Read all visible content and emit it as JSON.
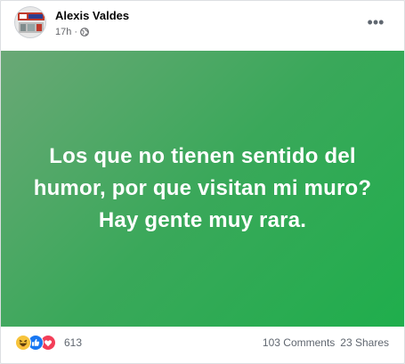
{
  "post": {
    "author": "Alexis Valdes",
    "time": "17h",
    "separator": "·",
    "privacy_icon": "globe-icon",
    "more_icon": "more-horizontal-icon",
    "more_label": "•••",
    "text": "Los que no tienen sentido del humor, por que visitan mi muro? Hay gente muy rara.",
    "background_colors": [
      "#6aa876",
      "#1fae4c"
    ]
  },
  "footer": {
    "reaction_icons": [
      "haha-icon",
      "like-icon",
      "love-icon"
    ],
    "reaction_count": "613",
    "comments": "103 Comments",
    "shares": "23 Shares"
  }
}
